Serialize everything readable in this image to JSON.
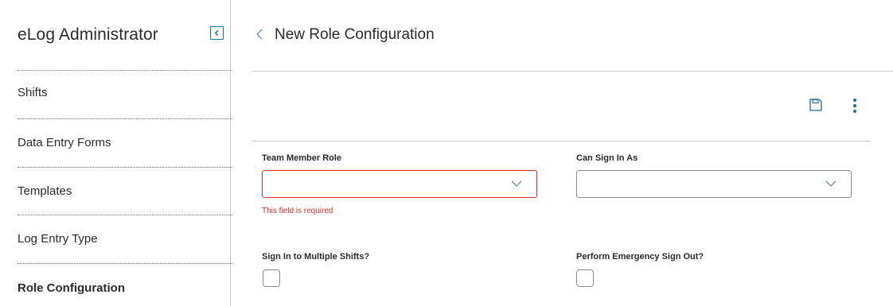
{
  "sidebar": {
    "title": "eLog Administrator",
    "collapse_icon": "collapse-left-icon",
    "items": [
      {
        "label": "Shifts",
        "active": false
      },
      {
        "label": "Data Entry Forms",
        "active": false
      },
      {
        "label": "Templates",
        "active": false
      },
      {
        "label": "Log Entry Type",
        "active": false
      },
      {
        "label": "Role Configuration",
        "active": true
      }
    ]
  },
  "header": {
    "back_icon": "chevron-left-icon",
    "title": "New Role Configuration"
  },
  "toolbar": {
    "save_icon": "save-icon",
    "more_icon": "more-vertical-icon"
  },
  "form": {
    "team_member_role": {
      "label": "Team Member Role",
      "value": "",
      "error": "This field is required"
    },
    "can_sign_in_as": {
      "label": "Can Sign In As",
      "value": ""
    },
    "sign_in_multiple": {
      "label": "Sign In to Multiple Shifts?",
      "checked": false
    },
    "emergency_sign_out": {
      "label": "Perform Emergency Sign Out?",
      "checked": false
    }
  },
  "colors": {
    "accent": "#1a6ea0",
    "error": "#e02b2b",
    "border": "#8a8a8a",
    "divider": "#c9c9c9"
  }
}
